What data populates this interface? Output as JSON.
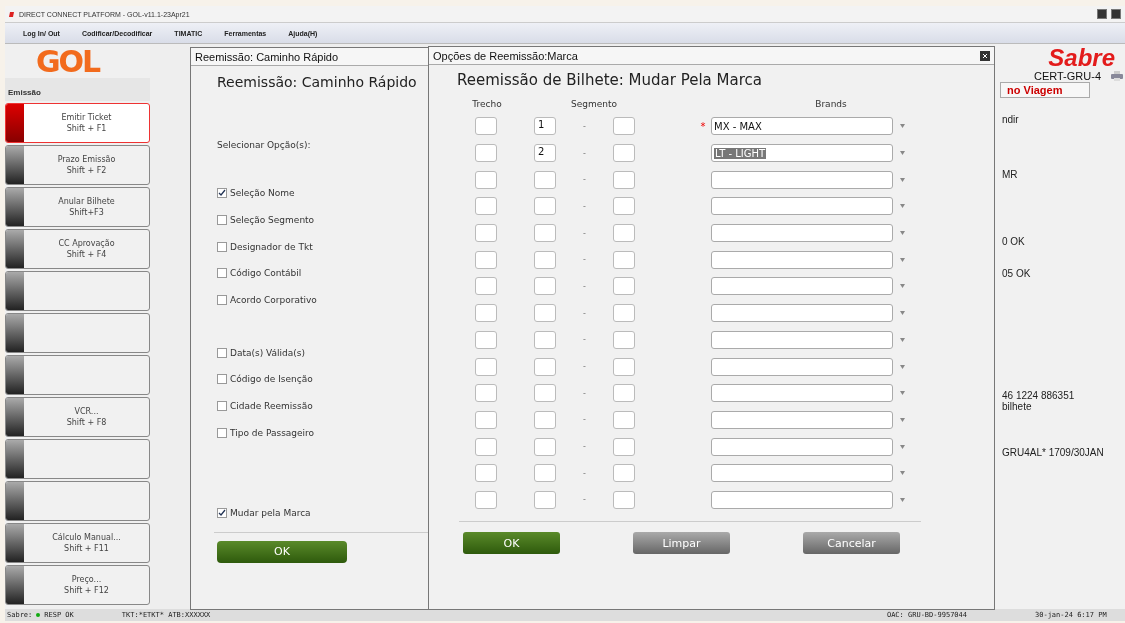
{
  "window": {
    "title": "DIRECT CONNECT PLATFORM - GOL-v11.1-23Apr21"
  },
  "menu": [
    "Log In/ Out",
    "Codificar/Decodificar",
    "TIMATIC",
    "Ferramentas",
    "Ajuda(H)"
  ],
  "sidebar": {
    "logo": "GOL",
    "header": "Emissão",
    "items": [
      {
        "label": "Emitir Ticket",
        "shortcut": "Shift + F1",
        "selected": true
      },
      {
        "label": "Prazo Emissão",
        "shortcut": "Shift + F2",
        "selected": false
      },
      {
        "label": "Anular Bilhete",
        "shortcut": "Shift+F3",
        "selected": false
      },
      {
        "label": "CC Aprovação",
        "shortcut": "Shift + F4",
        "selected": false
      },
      {
        "selected": false
      },
      {
        "selected": false
      },
      {
        "selected": false
      },
      {
        "label": "VCR...",
        "shortcut": "Shift + F8",
        "selected": false
      },
      {
        "selected": false
      },
      {
        "selected": false
      },
      {
        "label": "Cálculo Manual...",
        "shortcut": "Shift + F11",
        "selected": false
      },
      {
        "label": "Preço...",
        "shortcut": "Shift + F12",
        "selected": false
      }
    ]
  },
  "quick_dialog": {
    "title": "Reemissão: Caminho Rápido",
    "heading": "Reemissão: Caminho Rápido",
    "prompt": "Selecionar Opção(s):",
    "option_groups": [
      [
        {
          "label": "Seleção Nome",
          "checked": true
        },
        {
          "label": "Seleção Segmento",
          "checked": false
        },
        {
          "label": "Designador de Tkt",
          "checked": false
        },
        {
          "label": "Código Contábil",
          "checked": false
        },
        {
          "label": "Acordo Corporativo",
          "checked": false
        }
      ],
      [
        {
          "label": "Data(s) Válida(s)",
          "checked": false
        },
        {
          "label": "Código de Isenção",
          "checked": false
        },
        {
          "label": "Cidade Reemissão",
          "checked": false
        },
        {
          "label": "Tipo de Passageiro",
          "checked": false
        }
      ],
      [
        {
          "label": "Mudar pela Marca",
          "checked": true
        }
      ]
    ],
    "ok_button": "OK"
  },
  "right_panel": {
    "logo": "Sabre",
    "station": "CERT-GRU-4",
    "tab": "no Viagem",
    "lines": [
      "ndir",
      "MR",
      "0 OK",
      "05 OK",
      "46 1224 886351",
      "bilhete",
      "GRU4AL* 1709/30JAN"
    ]
  },
  "brand_dialog": {
    "title": "Opções de Reemissão:Marca",
    "heading": "Reemissão de Bilhete: Mudar Pela Marca",
    "columns": [
      "Trecho",
      "Segmento",
      "Brands"
    ],
    "rows": [
      {
        "segment": "1",
        "brand": "MX - MAX",
        "required": true,
        "highlighted": false
      },
      {
        "segment": "2",
        "brand": "LT - LIGHT",
        "required": false,
        "highlighted": true
      },
      {
        "required": false
      },
      {
        "required": false
      },
      {
        "required": false
      },
      {
        "required": false
      },
      {
        "required": false
      },
      {
        "required": false
      },
      {
        "required": false
      },
      {
        "required": false
      },
      {
        "required": false
      },
      {
        "required": false
      },
      {
        "required": false
      },
      {
        "required": false
      },
      {
        "required": false
      }
    ],
    "separator": "-",
    "required_marker": "*",
    "buttons": [
      {
        "label": "OK",
        "kind": "primary"
      },
      {
        "label": "Limpar",
        "kind": "secondary"
      },
      {
        "label": "Cancelar",
        "kind": "secondary"
      }
    ]
  },
  "status_bar": {
    "label": "Sabre:",
    "status": "RESP OK",
    "ticket": "TKT:*ETKT* ATB:XXXXXX",
    "oac": "OAC: GRU-BD-9957044",
    "datetime": "30-jan-24 6:17 PM"
  }
}
